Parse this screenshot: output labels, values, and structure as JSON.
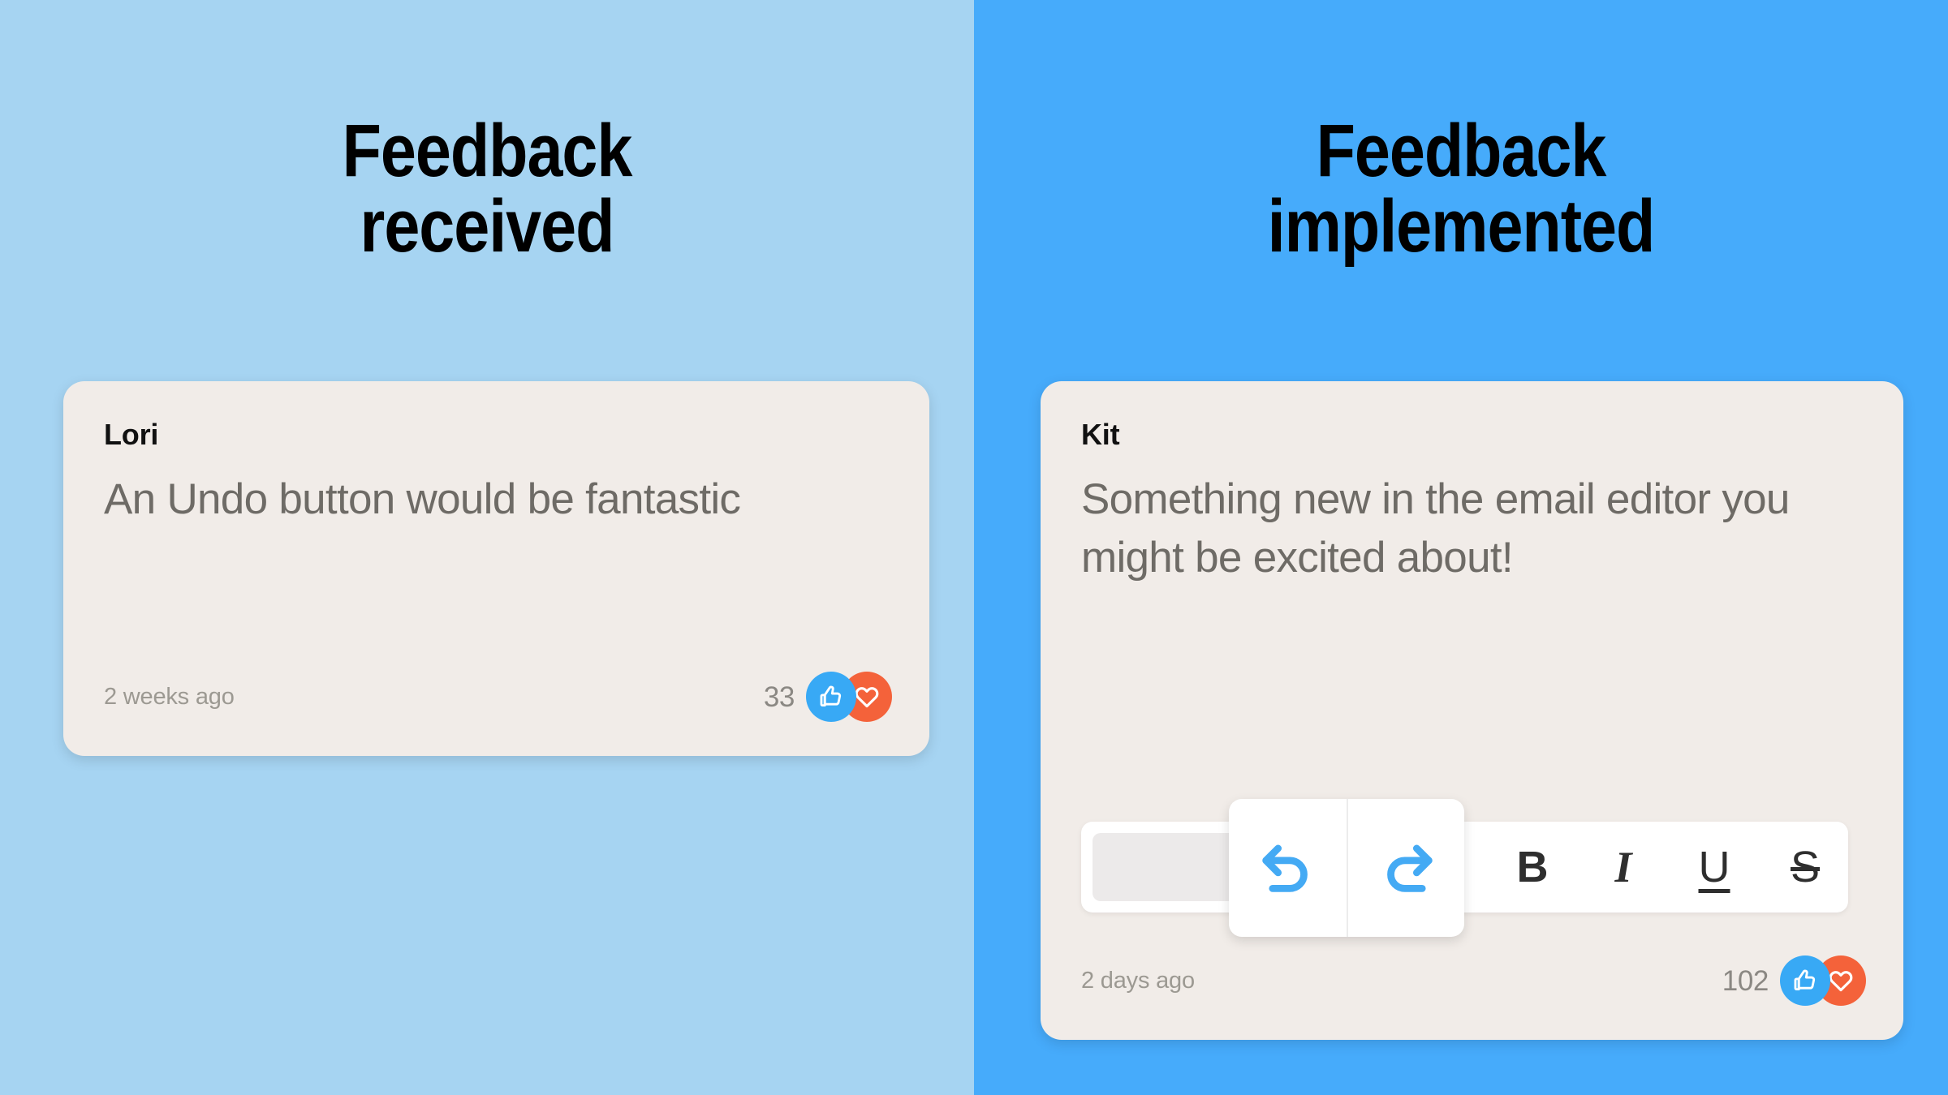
{
  "panels": [
    {
      "id": "feedback-received",
      "heading": "Feedback\nreceived",
      "background": "#a6d4f2",
      "card": {
        "author": "Lori",
        "body": "An Undo button would be fantastic",
        "timestamp": "2 weeks ago",
        "reaction_count": "33",
        "reactions": [
          {
            "name": "thumbs-up",
            "color": "#38a9f5"
          },
          {
            "name": "heart",
            "color": "#f4623a"
          }
        ]
      }
    },
    {
      "id": "feedback-implemented",
      "heading": "Feedback\nimplemented",
      "background": "#46abfb",
      "card": {
        "author": "Kit",
        "body": "Something new in the email editor you might be excited about!",
        "timestamp": "2 days ago",
        "reaction_count": "102",
        "reactions": [
          {
            "name": "thumbs-up",
            "color": "#38a9f5"
          },
          {
            "name": "heart",
            "color": "#f4623a"
          }
        ],
        "editor_toolbar": {
          "dropdown": {
            "value": "",
            "icon": "chevron-down-icon"
          },
          "history_buttons": [
            {
              "name": "undo-button",
              "icon": "undo-arrow-icon",
              "color": "#44aaf4"
            },
            {
              "name": "redo-button",
              "icon": "redo-arrow-icon",
              "color": "#44aaf4"
            }
          ],
          "format_buttons": [
            {
              "name": "bold-button",
              "label": "B"
            },
            {
              "name": "italic-button",
              "label": "I"
            },
            {
              "name": "underline-button",
              "label": "U"
            },
            {
              "name": "strikethrough-button",
              "label": "S"
            }
          ]
        }
      }
    }
  ],
  "colors": {
    "card_background": "#f1ece8",
    "body_text": "#6e6b66",
    "muted_text": "#9c9992",
    "heading_text": "#000000",
    "accent_blue": "#44aaf4",
    "accent_orange": "#f4623a"
  }
}
